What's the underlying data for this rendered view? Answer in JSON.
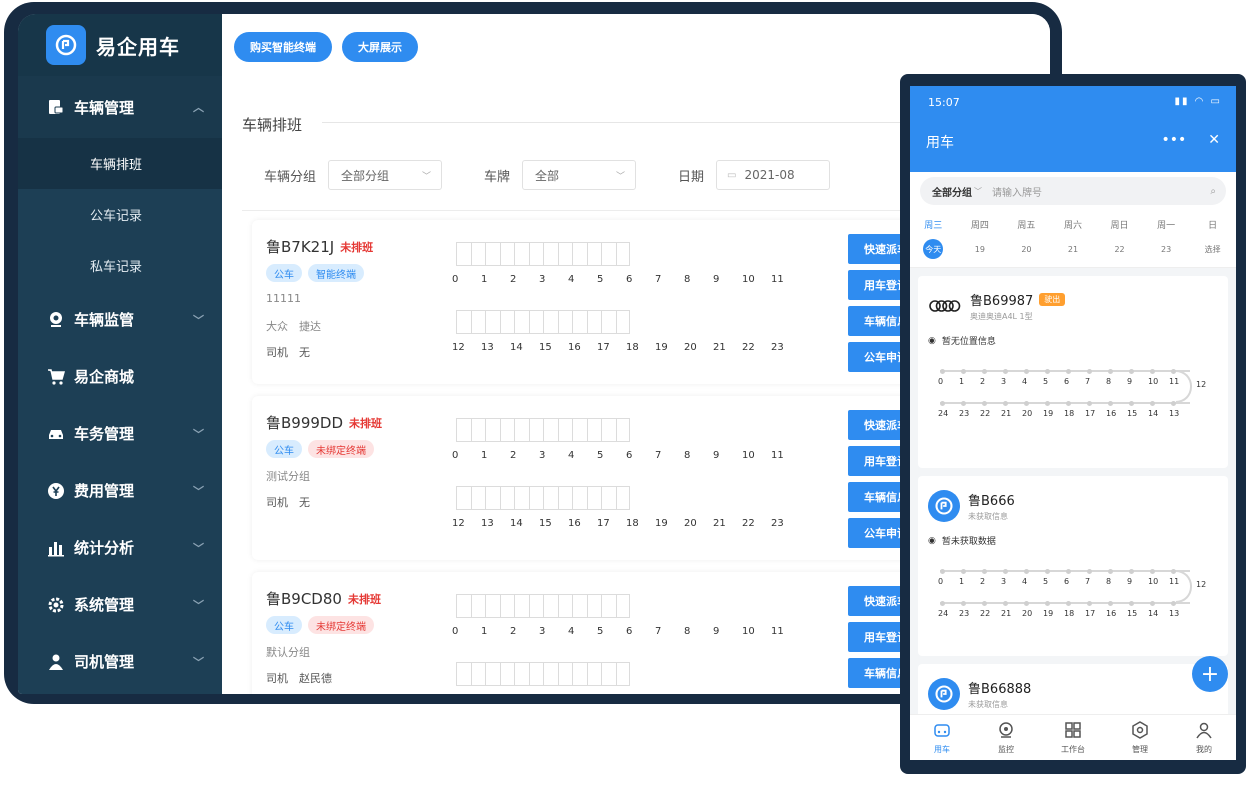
{
  "app": {
    "name": "易企用车"
  },
  "top_buttons": {
    "buy": "购买智能终端",
    "screen": "大屏展示"
  },
  "sidebar": {
    "groups": [
      {
        "label": "车辆管理",
        "icon": "car-doc-icon",
        "expanded": true
      },
      {
        "label": "车辆监管",
        "icon": "location-pin-icon"
      },
      {
        "label": "易企商城",
        "icon": "shopping-cart-icon"
      },
      {
        "label": "车务管理",
        "icon": "car-icon"
      },
      {
        "label": "费用管理",
        "icon": "yen-coin-icon"
      },
      {
        "label": "统计分析",
        "icon": "bar-chart-icon"
      },
      {
        "label": "系统管理",
        "icon": "gear-icon"
      },
      {
        "label": "司机管理",
        "icon": "driver-icon"
      }
    ],
    "sub_items": [
      "车辆排班",
      "公车记录",
      "私车记录"
    ]
  },
  "page": {
    "title": "车辆排班",
    "filters": {
      "group_label": "车辆分组",
      "group_value": "全部分组",
      "plate_label": "车牌",
      "plate_value": "全部",
      "date_label": "日期",
      "date_value": "2021-08"
    }
  },
  "hours_am": [
    "0",
    "1",
    "2",
    "3",
    "4",
    "5",
    "6",
    "7",
    "8",
    "9",
    "10",
    "11"
  ],
  "hours_pm": [
    "12",
    "13",
    "14",
    "15",
    "16",
    "17",
    "18",
    "19",
    "20",
    "21",
    "22",
    "23"
  ],
  "vehicles": [
    {
      "plate": "鲁B7K21J",
      "status": "未排班",
      "tags": [
        {
          "text": "公车",
          "color": "blue"
        },
        {
          "text": "智能终端",
          "color": "blue"
        }
      ],
      "line1": "11111",
      "line2": "大众　捷达",
      "driver": "司机　无"
    },
    {
      "plate": "鲁B999DD",
      "status": "未排班",
      "tags": [
        {
          "text": "公车",
          "color": "blue"
        },
        {
          "text": "未绑定终端",
          "color": "red"
        }
      ],
      "line1": "测试分组",
      "line2": "司机　无",
      "driver": ""
    },
    {
      "plate": "鲁B9CD80",
      "status": "未排班",
      "tags": [
        {
          "text": "公车",
          "color": "blue"
        },
        {
          "text": "未绑定终端",
          "color": "red"
        }
      ],
      "line1": "默认分组",
      "line2": "司机　赵民德",
      "driver": ""
    }
  ],
  "actions": [
    "快速派车",
    "用车登记",
    "车辆信息",
    "公车申请"
  ],
  "phone": {
    "time": "15:07",
    "title": "用车",
    "menu_dots": "•••",
    "close": "✕",
    "search_group": "全部分组",
    "search_placeholder": "请输入牌号",
    "days": [
      {
        "week": "周三",
        "date": "今天",
        "active": true
      },
      {
        "week": "周四",
        "date": "19"
      },
      {
        "week": "周五",
        "date": "20"
      },
      {
        "week": "周六",
        "date": "21"
      },
      {
        "week": "周日",
        "date": "22"
      },
      {
        "week": "周一",
        "date": "23"
      },
      {
        "week": "日",
        "date": "选择"
      }
    ],
    "cars": [
      {
        "plate": "鲁B69987",
        "badge": "驶出",
        "sub": "奥迪奥迪A4L 1型",
        "info": "暂无位置信息",
        "logo": "audi"
      },
      {
        "plate": "鲁B666",
        "sub": "未获取信息",
        "info": "暂未获取数据",
        "logo": "app"
      },
      {
        "plate": "鲁B66888",
        "sub": "未获取信息",
        "logo": "app"
      }
    ],
    "timeline_top": [
      "0",
      "1",
      "2",
      "3",
      "4",
      "5",
      "6",
      "7",
      "8",
      "9",
      "10",
      "11"
    ],
    "timeline_bottom": [
      "24",
      "23",
      "22",
      "21",
      "20",
      "19",
      "18",
      "17",
      "16",
      "15",
      "14",
      "13"
    ],
    "timeline_end": "12",
    "fab": "+",
    "tabs": [
      {
        "label": "用车",
        "active": true
      },
      {
        "label": "监控"
      },
      {
        "label": "工作台"
      },
      {
        "label": "管理"
      },
      {
        "label": "我的"
      }
    ]
  },
  "colors": {
    "primary": "#2f8cf0",
    "sidebar": "#1d3f55",
    "frame": "#172b42",
    "danger": "#e53935"
  }
}
